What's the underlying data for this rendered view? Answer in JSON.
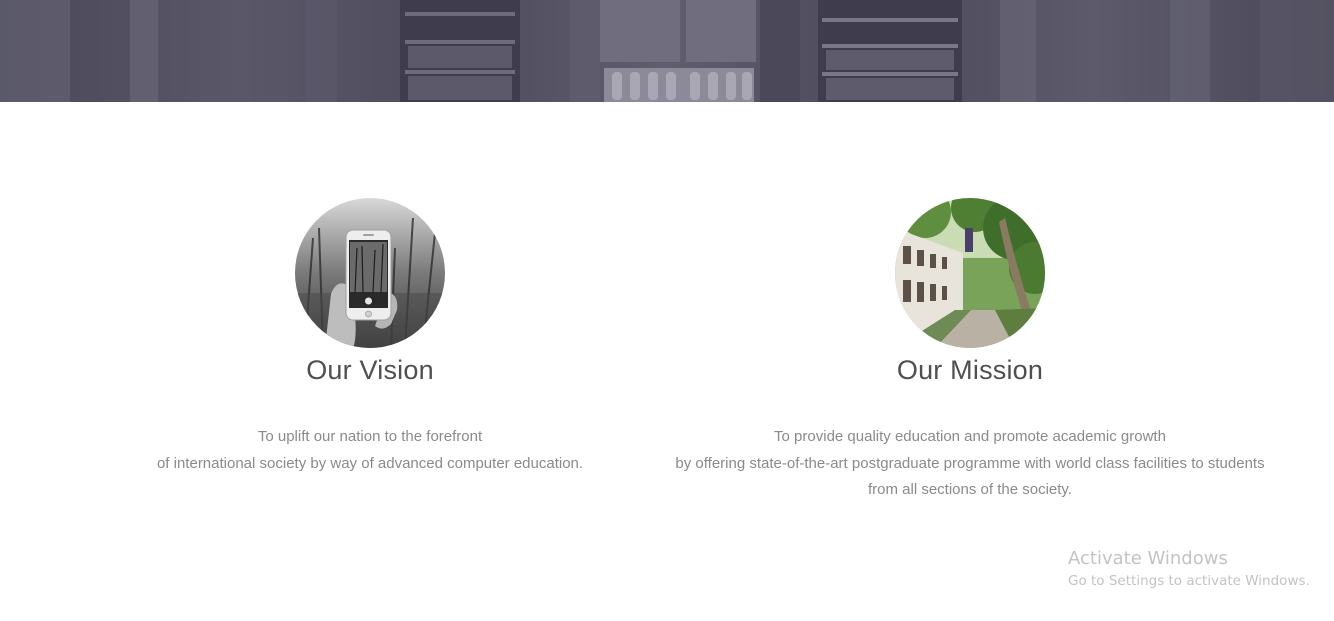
{
  "vision": {
    "title": "Our Vision",
    "lines": [
      "To uplift our nation to the forefront",
      "of international society by way of advanced computer education."
    ]
  },
  "mission": {
    "title": "Our Mission",
    "lines": [
      "To provide quality education and promote academic growth",
      "by offering state-of-the-art postgraduate programme with world class facilities to students",
      "from all sections of the society."
    ]
  },
  "watermark": {
    "title": "Activate Windows",
    "subtitle": "Go to Settings to activate Windows."
  },
  "colors": {
    "banner_overlay": "#4f4d5e",
    "heading": "#4f4f4f",
    "body_text": "#8a8a8a",
    "watermark": "#c3c3c3"
  }
}
